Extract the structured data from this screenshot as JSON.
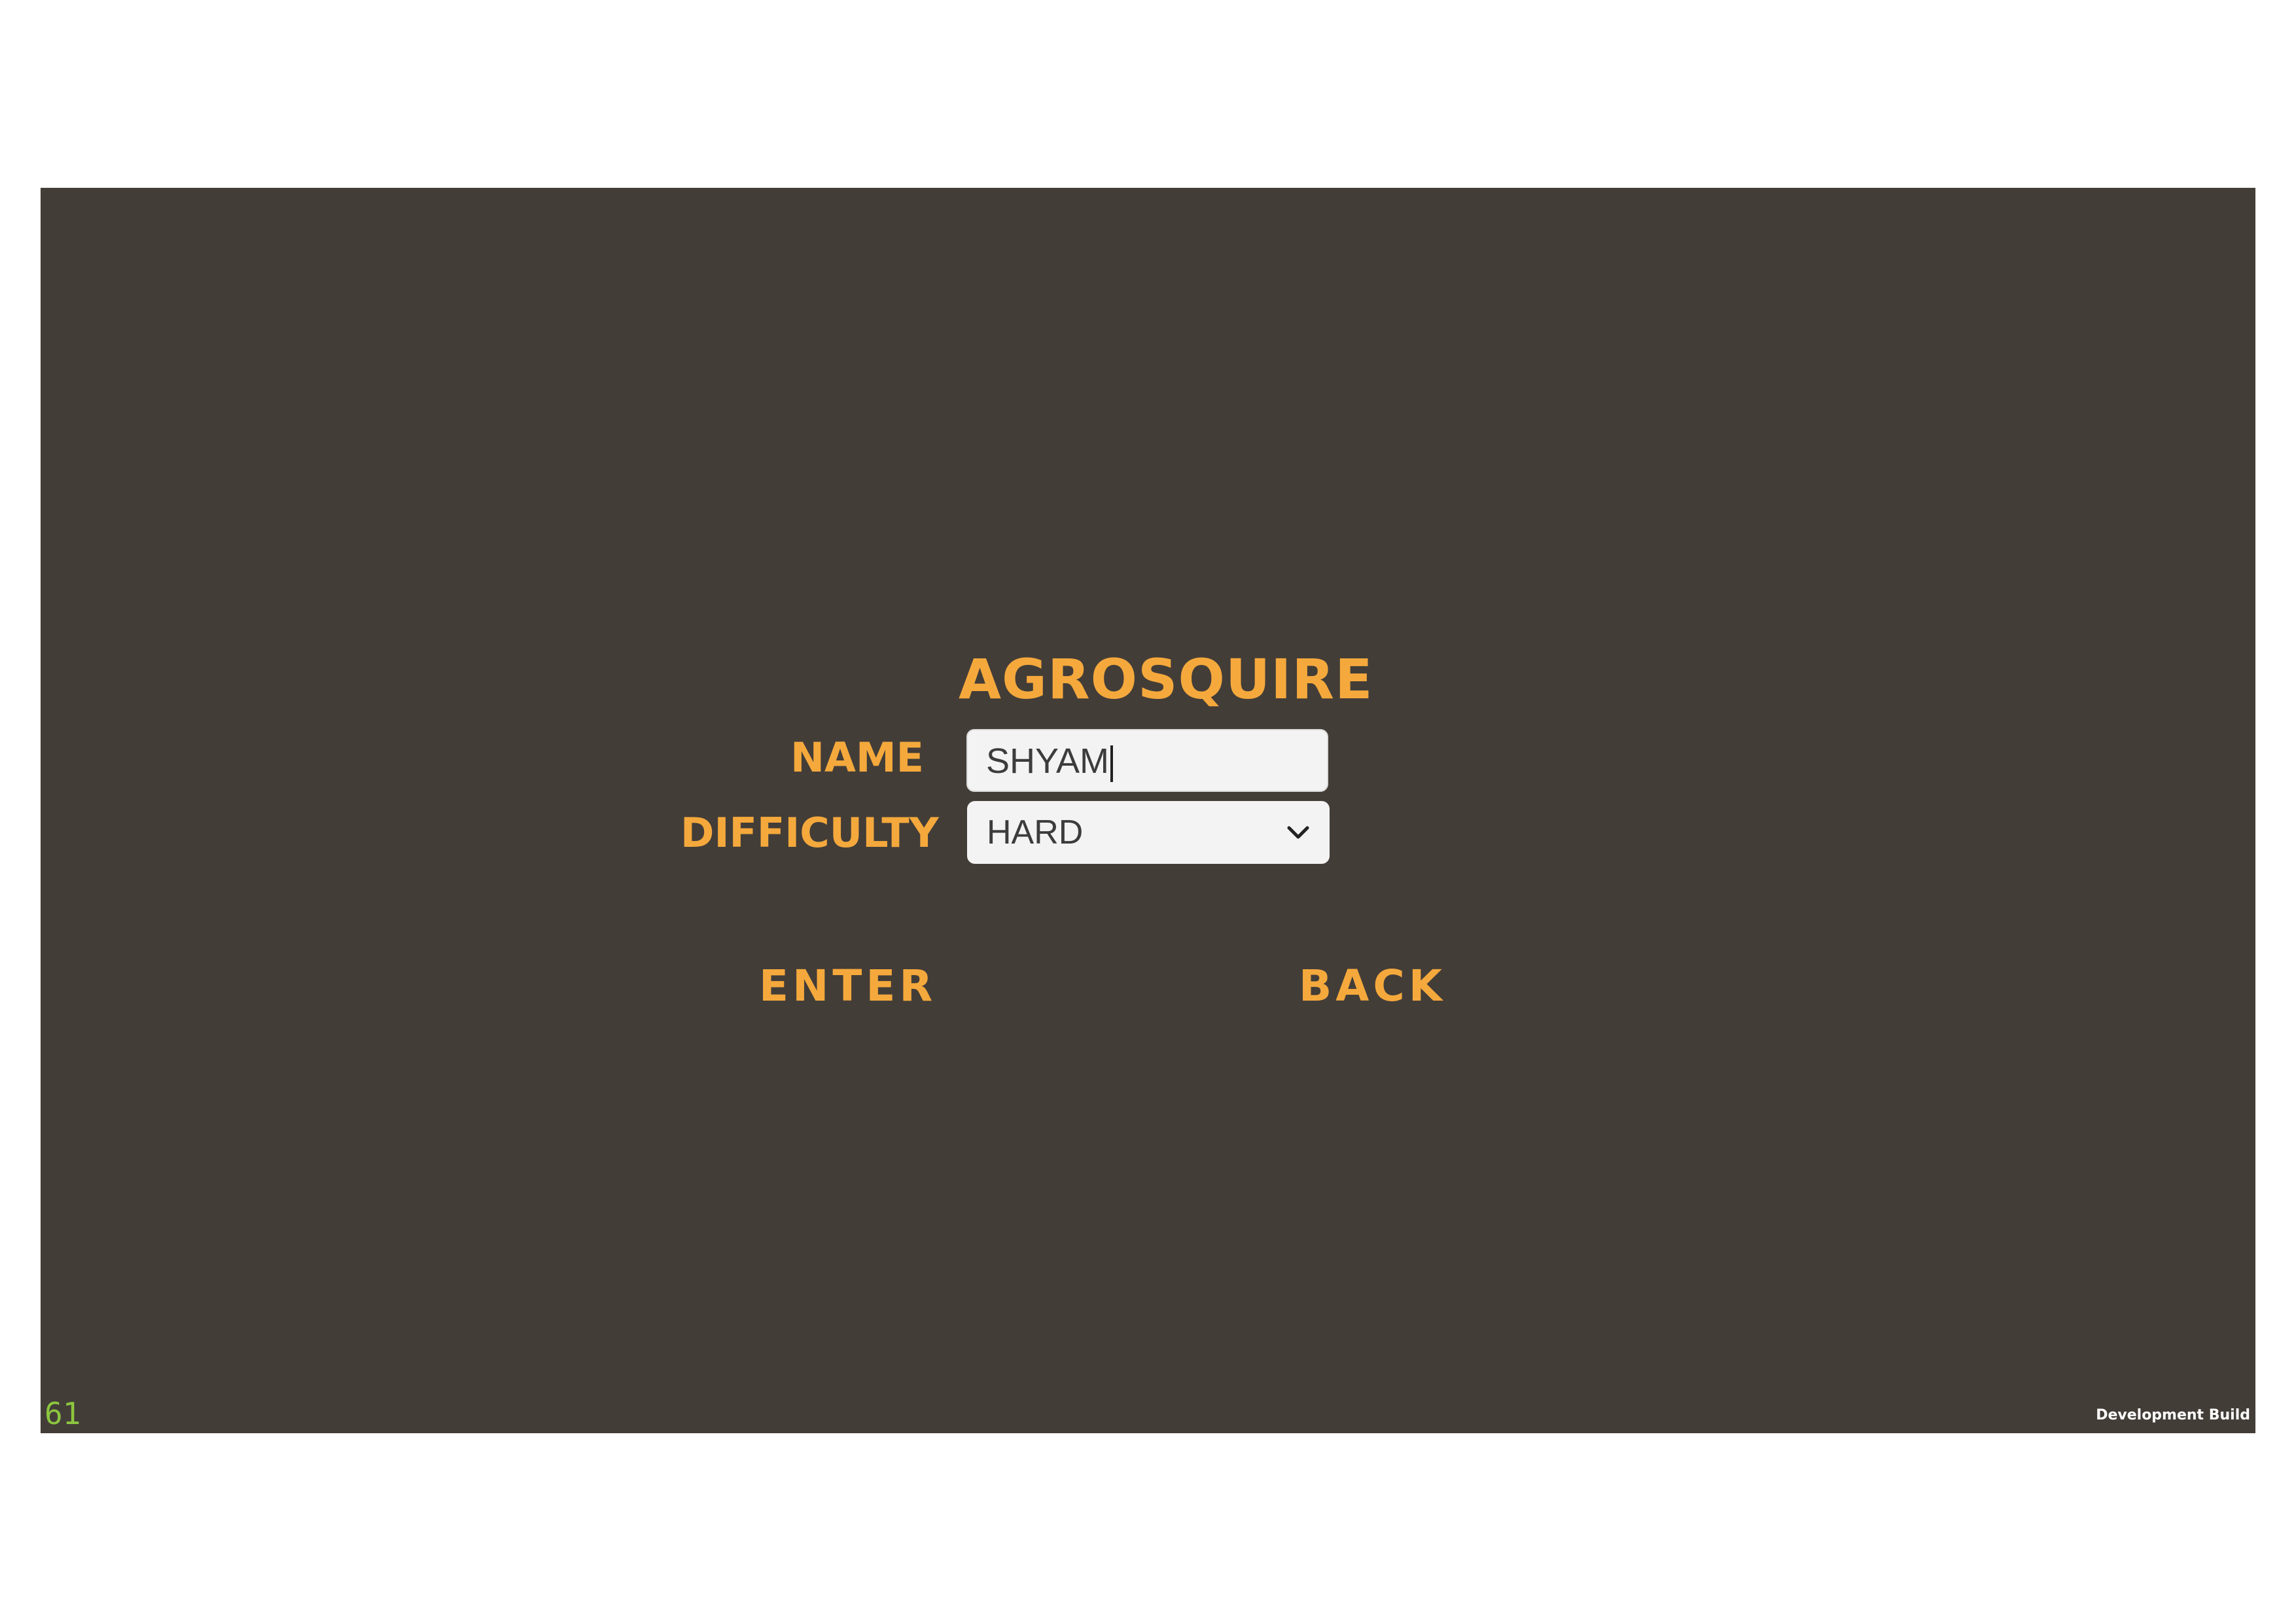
{
  "game": {
    "title": "AGROSQUIRE",
    "form": {
      "name_label": "NAME",
      "name_value": "SHYAM",
      "difficulty_label": "DIFFICULTY",
      "difficulty_selected": "HARD"
    },
    "buttons": {
      "enter": "ENTER",
      "back": "BACK"
    },
    "overlay": {
      "fps": "61",
      "build_label": "Development Build"
    },
    "icons": {
      "dropdown": "chevron-down-icon"
    },
    "colors": {
      "background": "#433d38",
      "accent": "#f5a93c",
      "fps_counter": "#8cc63f"
    }
  }
}
